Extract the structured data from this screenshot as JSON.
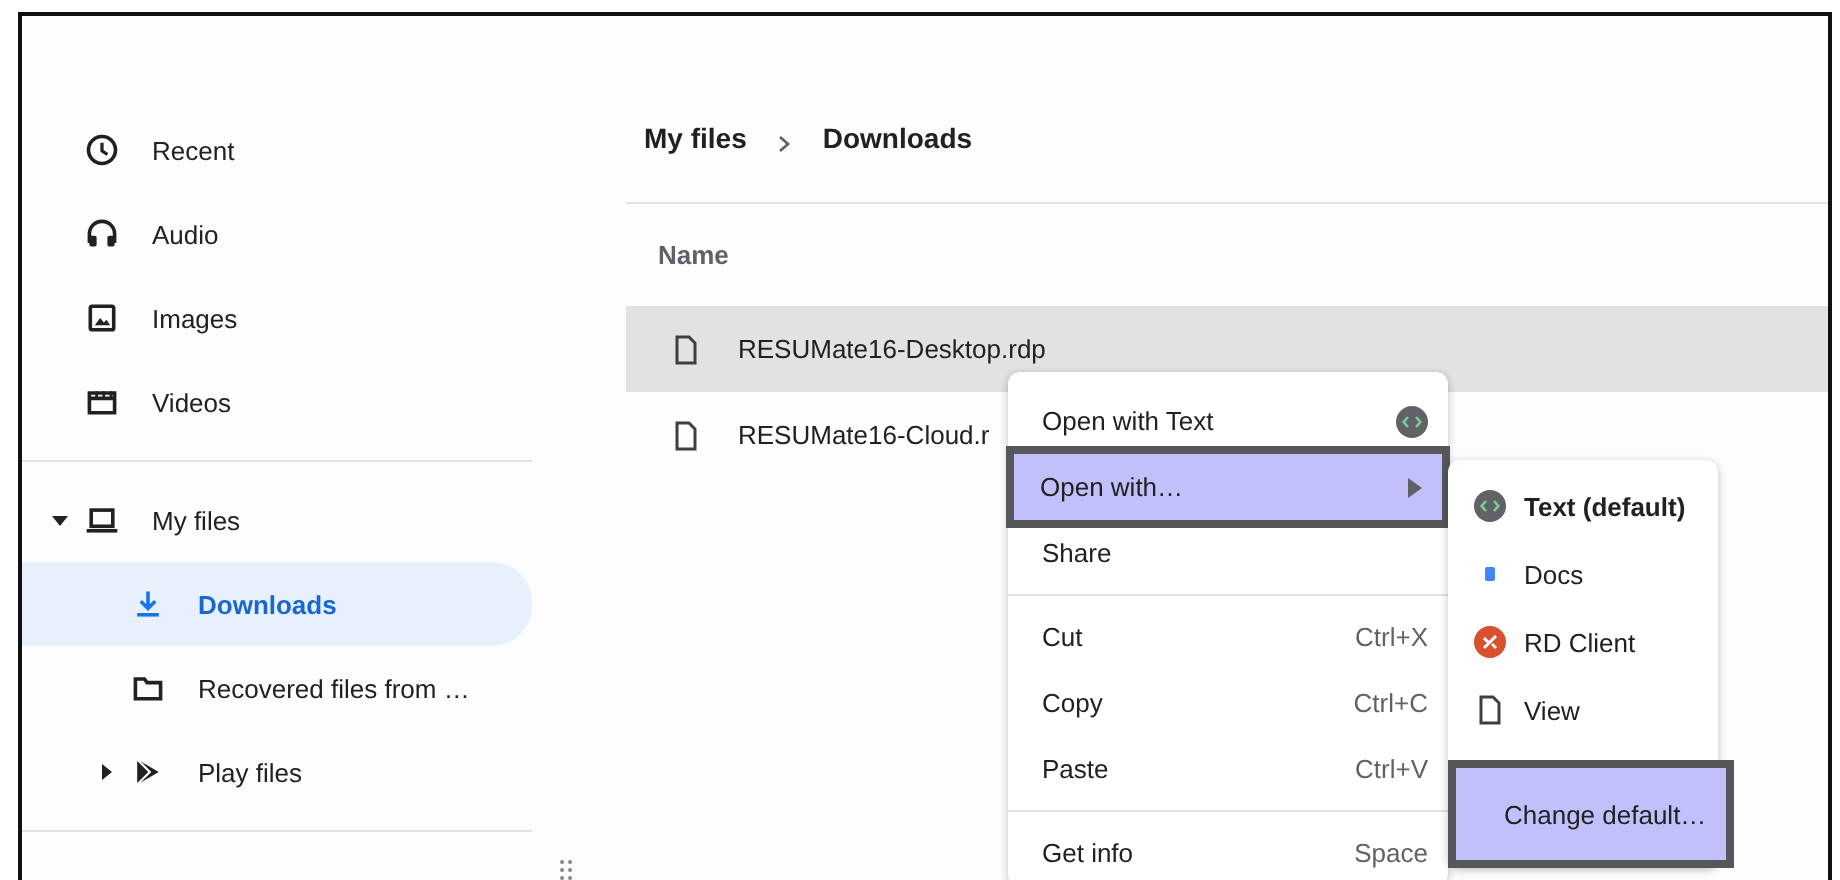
{
  "sidebar": {
    "items": [
      {
        "label": "Recent",
        "selected": false
      },
      {
        "label": "Audio",
        "selected": false
      },
      {
        "label": "Images",
        "selected": false
      },
      {
        "label": "Videos",
        "selected": false
      }
    ],
    "tree": [
      {
        "label": "My files",
        "selected": false,
        "expanded": true,
        "children": [
          {
            "label": "Downloads",
            "selected": true
          },
          {
            "label": "Recovered files from …",
            "selected": false
          },
          {
            "label": "Play files",
            "selected": false,
            "expanded": false
          }
        ]
      }
    ]
  },
  "breadcrumb": [
    "My files",
    "Downloads"
  ],
  "table": {
    "columns": [
      "Name"
    ],
    "rows": [
      {
        "name": "RESUMate16-Desktop.rdp",
        "selected": true
      },
      {
        "name": "RESUMate16-Cloud.r",
        "selected": false
      }
    ]
  },
  "context_menu": {
    "groups": [
      [
        {
          "label": "Open with Text",
          "app_icon": true,
          "submenu": false,
          "selected": false
        },
        {
          "label": "Open with…",
          "app_icon": false,
          "submenu": true,
          "selected": true
        },
        {
          "label": "Share",
          "app_icon": false,
          "submenu": false,
          "selected": false
        }
      ],
      [
        {
          "label": "Cut",
          "shortcut": "Ctrl+X",
          "app_icon": false,
          "submenu": false,
          "selected": false
        },
        {
          "label": "Copy",
          "shortcut": "Ctrl+C",
          "app_icon": false,
          "submenu": false,
          "selected": false
        },
        {
          "label": "Paste",
          "shortcut": "Ctrl+V",
          "app_icon": false,
          "submenu": false,
          "selected": false
        }
      ],
      [
        {
          "label": "Get info",
          "shortcut": "Space",
          "app_icon": false,
          "submenu": false,
          "selected": false
        }
      ]
    ]
  },
  "submenu": {
    "items": [
      {
        "label": "Text (default)",
        "kind": "text",
        "default": true,
        "selected": false
      },
      {
        "label": "Docs",
        "kind": "docs",
        "default": false,
        "selected": false
      },
      {
        "label": "RD Client",
        "kind": "rd",
        "default": false,
        "selected": false
      },
      {
        "label": "View",
        "kind": "view",
        "default": false,
        "selected": false
      },
      {
        "label": "Change default…",
        "kind": "plain",
        "default": false,
        "selected": true
      }
    ]
  }
}
